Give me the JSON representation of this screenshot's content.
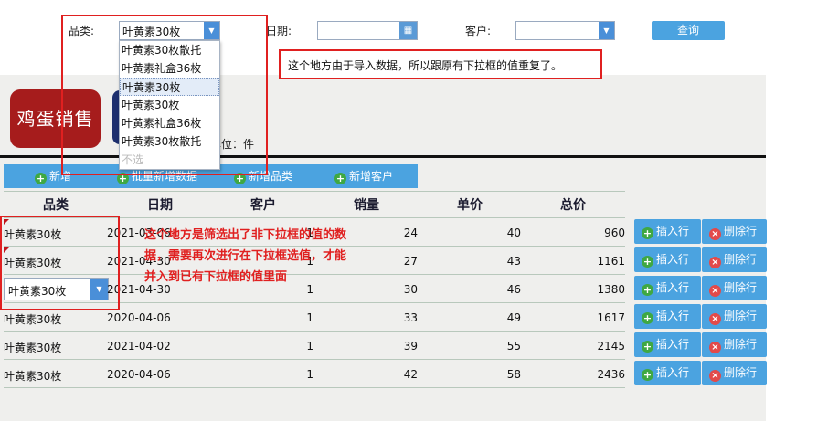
{
  "filters": {
    "category_label": "品类:",
    "category_value": "叶黄素30枚",
    "date_label": "日期:",
    "date_value": "",
    "customer_label": "客户:",
    "customer_value": "",
    "query_label": "查询"
  },
  "dropdown": {
    "options": [
      "叶黄素30枚散托",
      "叶黄素礼盒36枚",
      "叶黄素30枚",
      "叶黄素30枚",
      "叶黄素礼盒36枚",
      "叶黄素30枚散托",
      "不选"
    ],
    "highlighted_index": 2
  },
  "annotations": {
    "note_top": "这个地方由于导入数据，所以跟原有下拉框的值重复了。",
    "note_table": "这个地方是筛选出了非下拉框的值的数据，需要再次进行在下拉框选值，才能并入到已有下拉框的值里面"
  },
  "logo_text": "鸡蛋销售",
  "unit_text": "单位：件",
  "toolbar": {
    "btn1": "新增",
    "btn2": "批量新增数据",
    "btn3": "新增品类",
    "btn4": "新增客户"
  },
  "table": {
    "headers": [
      "品类",
      "日期",
      "客户",
      "销量",
      "单价",
      "总价"
    ],
    "rows": [
      {
        "category": "叶黄素30枚",
        "date": "2021-03-06",
        "customer": "1",
        "qty": "24",
        "price": "40",
        "total": "960"
      },
      {
        "category": "叶黄素30枚",
        "date": "2021-04-30",
        "customer": "1",
        "qty": "27",
        "price": "43",
        "total": "1161"
      },
      {
        "category": "叶黄素30枚",
        "date": "2021-04-30",
        "customer": "1",
        "qty": "30",
        "price": "46",
        "total": "1380"
      },
      {
        "category": "叶黄素30枚",
        "date": "2020-04-06",
        "customer": "1",
        "qty": "33",
        "price": "49",
        "total": "1617"
      },
      {
        "category": "叶黄素30枚",
        "date": "2021-04-02",
        "customer": "1",
        "qty": "39",
        "price": "55",
        "total": "2145"
      },
      {
        "category": "叶黄素30枚",
        "date": "2020-04-06",
        "customer": "1",
        "qty": "42",
        "price": "58",
        "total": "2436"
      }
    ],
    "insert_label": "插入行",
    "delete_label": "删除行"
  },
  "colors": {
    "accent": "#4ba3e0",
    "annotation": "#e02020",
    "logo": "#a61c1c"
  }
}
